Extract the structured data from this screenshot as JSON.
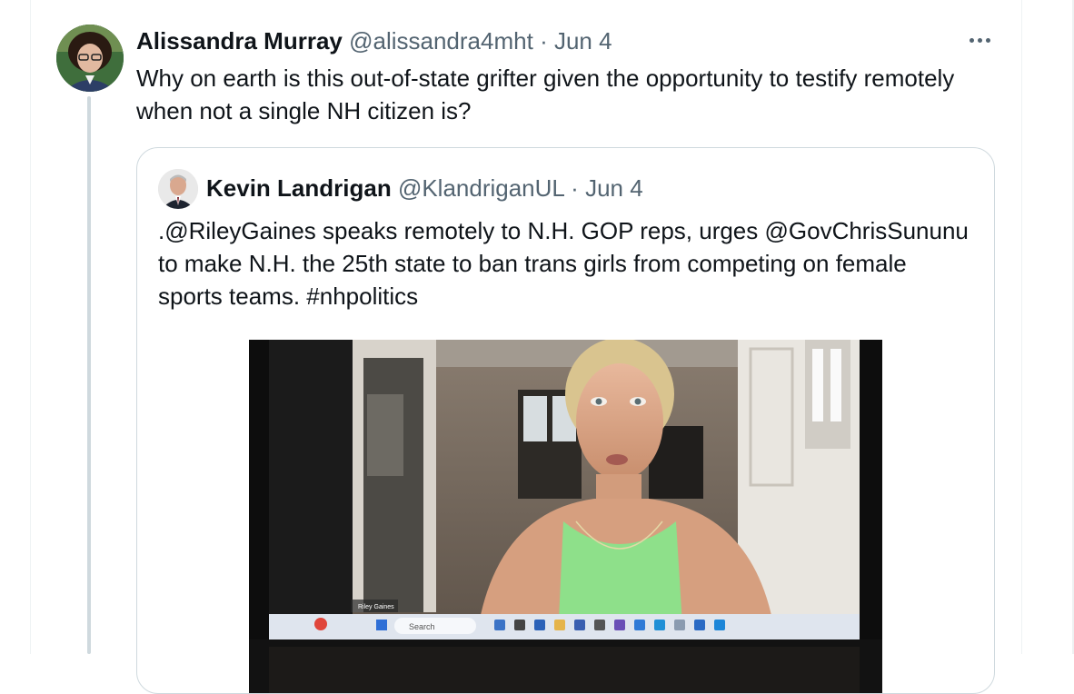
{
  "tweet": {
    "author_name": "Alissandra Murray",
    "author_handle": "@alissandra4mht",
    "separator": "·",
    "date": "Jun 4",
    "text": "Why on earth is this out-of-state grifter given the opportunity to testify remotely when not a single NH citizen is?",
    "more_icon": "more-horizontal-icon"
  },
  "quoted": {
    "author_name": "Kevin Landrigan",
    "author_handle": "@KlandriganUL",
    "separator": "·",
    "date": "Jun 4",
    "text": ".@RileyGaines speaks remotely to N.H. GOP reps, urges @GovChrisSununu to make N.H. the 25th state to ban trans girls from competing on female sports teams. #nhpolitics"
  },
  "video": {
    "participant_label": "Riley Gaines",
    "taskbar_search": "Search"
  },
  "colors": {
    "text": "#0f1419",
    "muted": "#536471",
    "border": "#cfd9de",
    "thread_line": "#cfd9de"
  }
}
